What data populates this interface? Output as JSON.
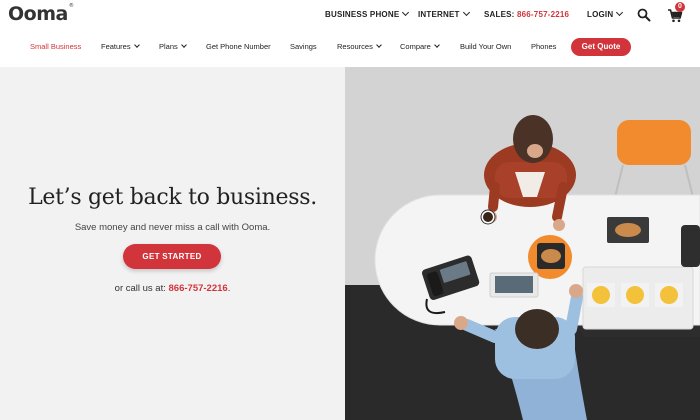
{
  "brand": {
    "logo_text": "Ooma",
    "trademark": "®"
  },
  "utility_nav": {
    "business_phone": "BUSINESS PHONE",
    "internet": "INTERNET",
    "sales_label": "SALES:",
    "sales_number": "866-757-2216",
    "login": "LOGIN",
    "cart_count": "0"
  },
  "main_nav": {
    "items": [
      "Small Business",
      "Features",
      "Plans",
      "Get Phone Number",
      "Savings",
      "Resources",
      "Compare",
      "Build Your Own",
      "Phones"
    ],
    "cta": "Get Quote"
  },
  "hero": {
    "title": "Let’s get back to business.",
    "subtitle": "Save money and never miss a call with Ooma.",
    "cta_label": "GET STARTED",
    "call_prefix": "or call us at:",
    "call_number": "866-757-2216",
    "call_suffix": "."
  },
  "colors": {
    "accent": "#d2343b",
    "hero_bg": "#f2f2f2"
  },
  "icons": [
    "chevron-down-icon",
    "search-icon",
    "cart-icon"
  ]
}
